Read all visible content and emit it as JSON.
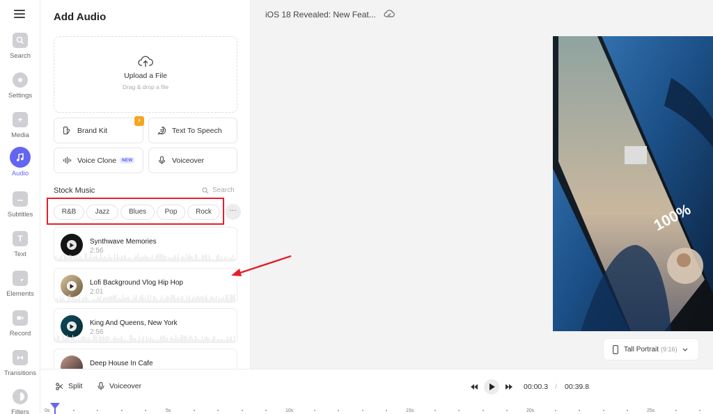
{
  "rail": {
    "items": [
      {
        "label": "Search"
      },
      {
        "label": "Settings"
      },
      {
        "label": "Media"
      },
      {
        "label": "Audio"
      },
      {
        "label": "Subtitles"
      },
      {
        "label": "Text"
      },
      {
        "label": "Elements"
      },
      {
        "label": "Record"
      },
      {
        "label": "Transitions"
      },
      {
        "label": "Filters"
      }
    ]
  },
  "panel": {
    "title": "Add Audio",
    "upload": {
      "title": "Upload a File",
      "subtitle": "Drag & drop a file"
    },
    "tools": {
      "brand_kit": "Brand Kit",
      "text_to_speech": "Text To Speech",
      "voice_clone": "Voice Clone",
      "voice_clone_badge": "NEW",
      "voiceover": "Voiceover"
    },
    "stock_music": {
      "heading": "Stock Music",
      "search_placeholder": "Search",
      "genres": [
        "R&B",
        "Jazz",
        "Blues",
        "Pop",
        "Rock"
      ],
      "more": "···"
    },
    "tracks": [
      {
        "name": "Synthwave Memories",
        "duration": "2:56"
      },
      {
        "name": "Lofi Background Vlog Hip Hop",
        "duration": "2:01"
      },
      {
        "name": "King And Queens, New York",
        "duration": "2:56"
      },
      {
        "name": "Deep House In Cafe",
        "duration": ""
      }
    ]
  },
  "header": {
    "doc_title": "iOS 18 Revealed: New Feat..."
  },
  "canvas": {
    "aspect_label": "Tall Portrait",
    "aspect_ratio": "(9:16)"
  },
  "bottom": {
    "split": "Split",
    "voiceover": "Voiceover",
    "current_time": "00:00.3",
    "separator": "/",
    "total_time": "00:39.8",
    "ruler_labels": [
      "0s",
      "5s",
      "10s",
      "15s",
      "20s",
      "25s"
    ]
  },
  "colors": {
    "accent": "#6366f1",
    "highlight": "#e3202a",
    "badge": "#f5a524"
  }
}
